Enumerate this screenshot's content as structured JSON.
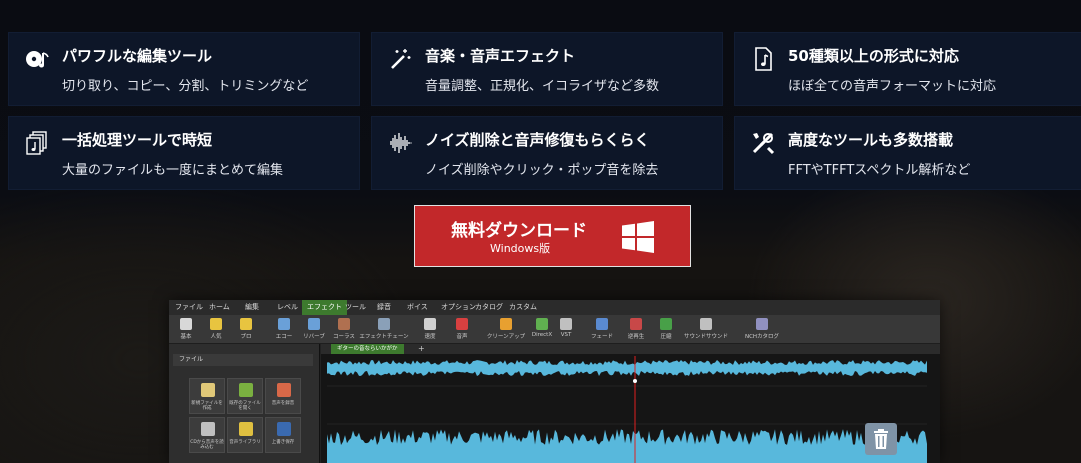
{
  "features": [
    {
      "icon": "music-disc-icon",
      "title": "パワフルな編集ツール",
      "desc": "切り取り、コピー、分割、トリミングなど"
    },
    {
      "icon": "magic-wand-icon",
      "title": "音楽・音声エフェクト",
      "desc": "音量調整、正規化、イコライザなど多数"
    },
    {
      "icon": "music-file-icon",
      "title": "50種類以上の形式に対応",
      "desc": "ほぼ全ての音声フォーマットに対応"
    },
    {
      "icon": "batch-files-icon",
      "title": "一括処理ツールで時短",
      "desc": "大量のファイルも一度にまとめて編集"
    },
    {
      "icon": "waveform-icon",
      "title": "ノイズ削除と音声修復もらくらく",
      "desc": "ノイズ削除やクリック・ポップ音を除去"
    },
    {
      "icon": "tools-icon",
      "title": "高度なツールも多数搭載",
      "desc": "FFTやTFFTスペクトル解析など"
    }
  ],
  "download": {
    "label": "無料ダウンロード",
    "sublabel": "Windows版",
    "icon": "windows-logo-icon",
    "color": "#c2282a"
  },
  "app": {
    "menu": [
      "ファイル",
      "ホーム",
      "編集",
      "レベル",
      "エフェクト",
      "ツール",
      "録音",
      "ボイス",
      "オプション",
      "カタログ",
      "カスタム"
    ],
    "active_menu": "エフェクト",
    "ribbon": [
      "基本",
      "人気",
      "プロ",
      "エコー",
      "リバーブ",
      "コーラス",
      "エフェクトチェーン",
      "速度",
      "音声",
      "クリーンアップ",
      "DirectX",
      "VST",
      "フェード",
      "逆再生",
      "圧縮",
      "サウンドサウンド",
      "NCHカタログ"
    ],
    "sidebar_title": "ファイル",
    "sidebar_items": [
      "新規ファイルを作成",
      "既存のファイルを開く",
      "音声を録音",
      "CDから音声を読み込む",
      "音声ライブラリ",
      "上書き保存"
    ],
    "tab_label": "ギターの音ならいかがか",
    "accent_color": "#3d7a2e",
    "wave_color": "#58b8dc"
  }
}
